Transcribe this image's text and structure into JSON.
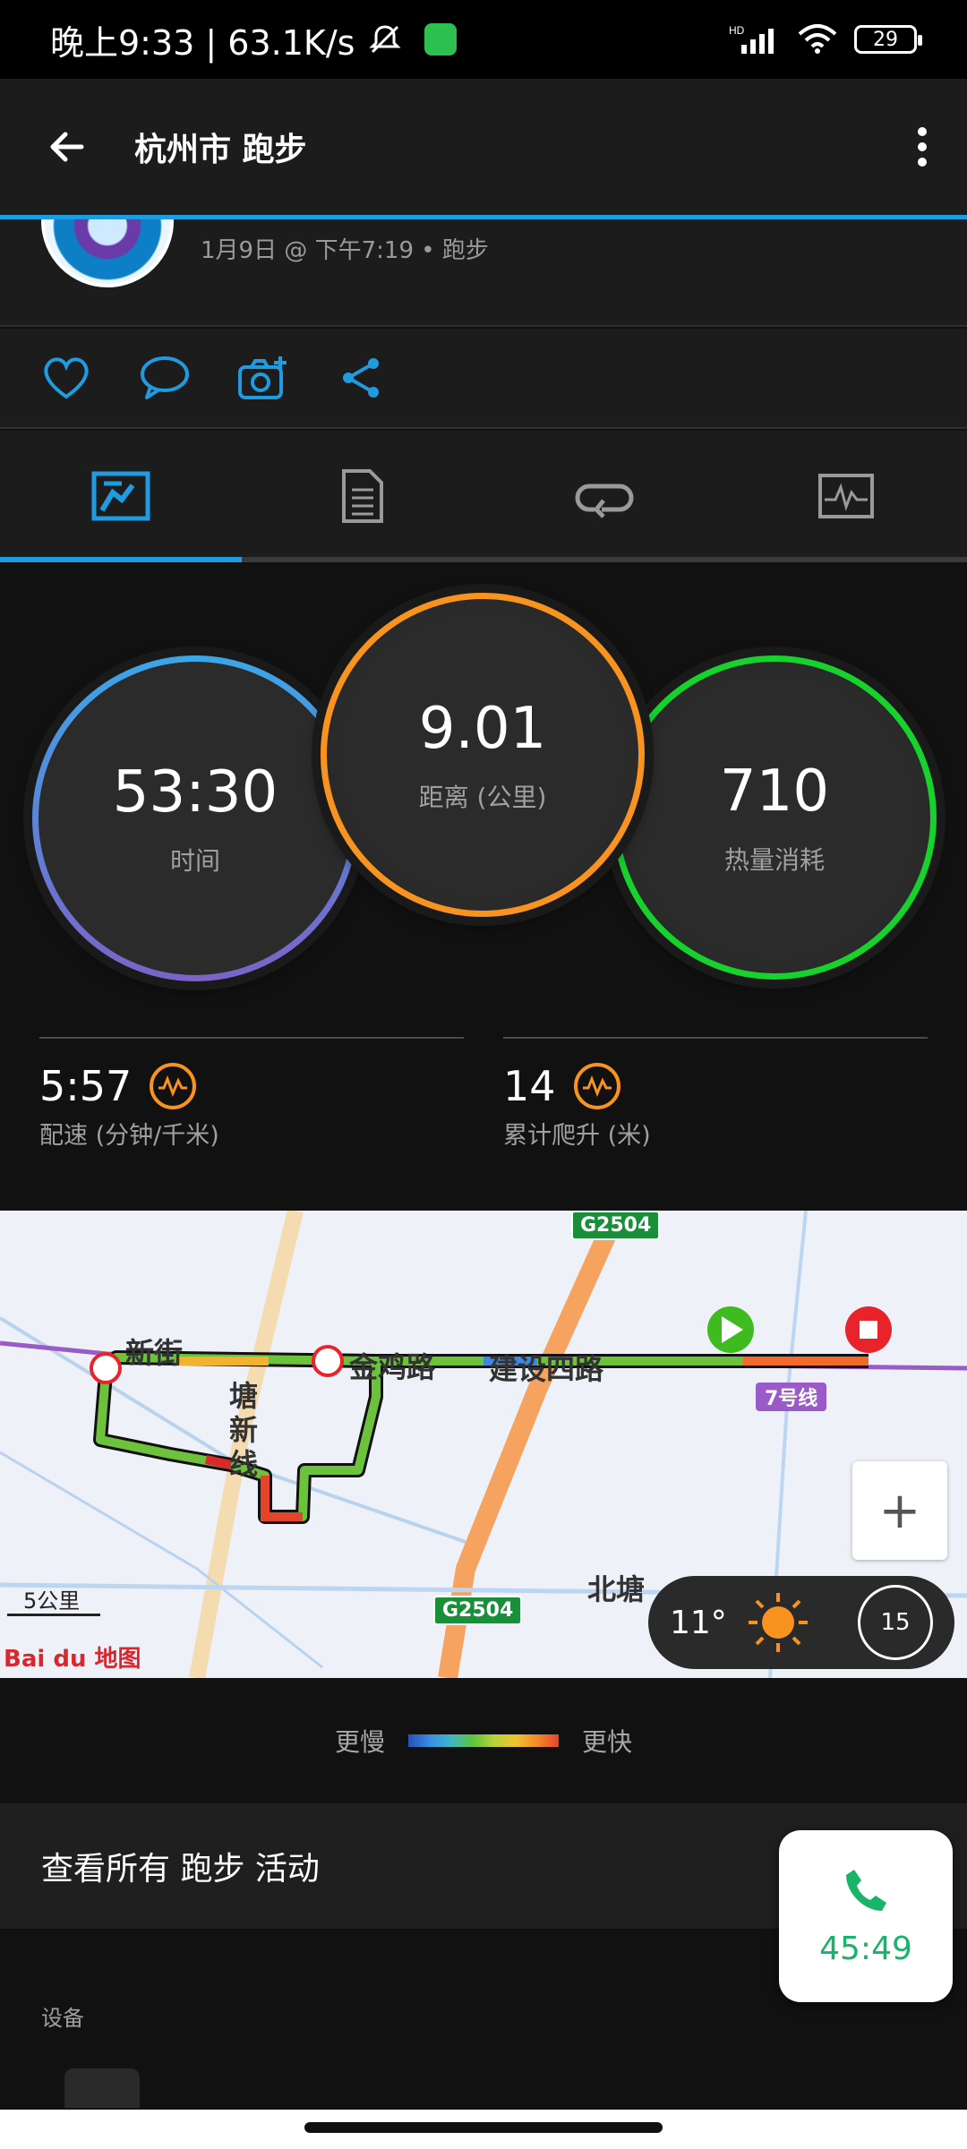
{
  "status_bar": {
    "time_speed": "晚上9:33 | 63.1K/s",
    "signal_label": "HD",
    "battery": "29"
  },
  "app_bar": {
    "title": "杭州市 跑步"
  },
  "activity": {
    "meta": "1月9日 @ 下午7:19 • 跑步"
  },
  "stats": {
    "time": {
      "value": "53:30",
      "label": "时间"
    },
    "distance": {
      "value": "9.01",
      "label": "距离 (公里)"
    },
    "calories": {
      "value": "710",
      "label": "热量消耗"
    },
    "pace": {
      "value": "5:57",
      "label": "配速 (分钟/千米)"
    },
    "elevation": {
      "value": "14",
      "label": "累计爬升 (米)"
    }
  },
  "map": {
    "labels": {
      "xinjie": "新街",
      "tang_xin_line": "塘新线",
      "jinlu": "金鸡路",
      "jianshe": "建设四路",
      "beitang": "北塘",
      "line7": "7号线"
    },
    "road_signs": {
      "top": "G2504",
      "bottom": "G2504"
    },
    "zoom_in": "+",
    "scale": "5公里",
    "logo": "Bai du 地图",
    "weather": {
      "temp": "11°",
      "wind": "15"
    }
  },
  "legend": {
    "slower": "更慢",
    "faster": "更快"
  },
  "view_all": "查看所有 跑步 活动",
  "device_label": "设备",
  "call": {
    "duration": "45:49"
  },
  "colors": {
    "accent": "#1f9be0",
    "distance_ring": "#f7931e",
    "calories_ring": "#17d12d",
    "call_green": "#18b46a"
  }
}
